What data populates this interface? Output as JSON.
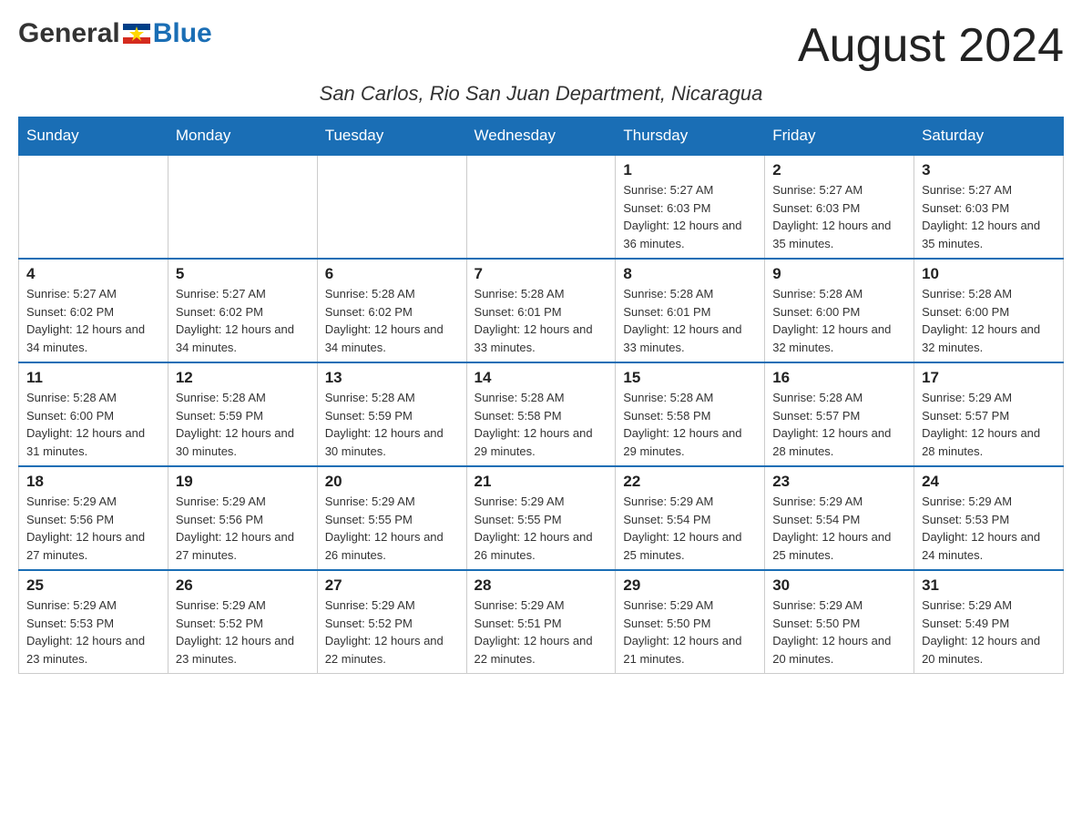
{
  "header": {
    "logo": {
      "general": "General",
      "blue": "Blue"
    },
    "month_title": "August 2024",
    "location": "San Carlos, Rio San Juan Department, Nicaragua"
  },
  "weekdays": [
    "Sunday",
    "Monday",
    "Tuesday",
    "Wednesday",
    "Thursday",
    "Friday",
    "Saturday"
  ],
  "weeks": [
    [
      {
        "day": "",
        "info": ""
      },
      {
        "day": "",
        "info": ""
      },
      {
        "day": "",
        "info": ""
      },
      {
        "day": "",
        "info": ""
      },
      {
        "day": "1",
        "info": "Sunrise: 5:27 AM\nSunset: 6:03 PM\nDaylight: 12 hours and 36 minutes."
      },
      {
        "day": "2",
        "info": "Sunrise: 5:27 AM\nSunset: 6:03 PM\nDaylight: 12 hours and 35 minutes."
      },
      {
        "day": "3",
        "info": "Sunrise: 5:27 AM\nSunset: 6:03 PM\nDaylight: 12 hours and 35 minutes."
      }
    ],
    [
      {
        "day": "4",
        "info": "Sunrise: 5:27 AM\nSunset: 6:02 PM\nDaylight: 12 hours and 34 minutes."
      },
      {
        "day": "5",
        "info": "Sunrise: 5:27 AM\nSunset: 6:02 PM\nDaylight: 12 hours and 34 minutes."
      },
      {
        "day": "6",
        "info": "Sunrise: 5:28 AM\nSunset: 6:02 PM\nDaylight: 12 hours and 34 minutes."
      },
      {
        "day": "7",
        "info": "Sunrise: 5:28 AM\nSunset: 6:01 PM\nDaylight: 12 hours and 33 minutes."
      },
      {
        "day": "8",
        "info": "Sunrise: 5:28 AM\nSunset: 6:01 PM\nDaylight: 12 hours and 33 minutes."
      },
      {
        "day": "9",
        "info": "Sunrise: 5:28 AM\nSunset: 6:00 PM\nDaylight: 12 hours and 32 minutes."
      },
      {
        "day": "10",
        "info": "Sunrise: 5:28 AM\nSunset: 6:00 PM\nDaylight: 12 hours and 32 minutes."
      }
    ],
    [
      {
        "day": "11",
        "info": "Sunrise: 5:28 AM\nSunset: 6:00 PM\nDaylight: 12 hours and 31 minutes."
      },
      {
        "day": "12",
        "info": "Sunrise: 5:28 AM\nSunset: 5:59 PM\nDaylight: 12 hours and 30 minutes."
      },
      {
        "day": "13",
        "info": "Sunrise: 5:28 AM\nSunset: 5:59 PM\nDaylight: 12 hours and 30 minutes."
      },
      {
        "day": "14",
        "info": "Sunrise: 5:28 AM\nSunset: 5:58 PM\nDaylight: 12 hours and 29 minutes."
      },
      {
        "day": "15",
        "info": "Sunrise: 5:28 AM\nSunset: 5:58 PM\nDaylight: 12 hours and 29 minutes."
      },
      {
        "day": "16",
        "info": "Sunrise: 5:28 AM\nSunset: 5:57 PM\nDaylight: 12 hours and 28 minutes."
      },
      {
        "day": "17",
        "info": "Sunrise: 5:29 AM\nSunset: 5:57 PM\nDaylight: 12 hours and 28 minutes."
      }
    ],
    [
      {
        "day": "18",
        "info": "Sunrise: 5:29 AM\nSunset: 5:56 PM\nDaylight: 12 hours and 27 minutes."
      },
      {
        "day": "19",
        "info": "Sunrise: 5:29 AM\nSunset: 5:56 PM\nDaylight: 12 hours and 27 minutes."
      },
      {
        "day": "20",
        "info": "Sunrise: 5:29 AM\nSunset: 5:55 PM\nDaylight: 12 hours and 26 minutes."
      },
      {
        "day": "21",
        "info": "Sunrise: 5:29 AM\nSunset: 5:55 PM\nDaylight: 12 hours and 26 minutes."
      },
      {
        "day": "22",
        "info": "Sunrise: 5:29 AM\nSunset: 5:54 PM\nDaylight: 12 hours and 25 minutes."
      },
      {
        "day": "23",
        "info": "Sunrise: 5:29 AM\nSunset: 5:54 PM\nDaylight: 12 hours and 25 minutes."
      },
      {
        "day": "24",
        "info": "Sunrise: 5:29 AM\nSunset: 5:53 PM\nDaylight: 12 hours and 24 minutes."
      }
    ],
    [
      {
        "day": "25",
        "info": "Sunrise: 5:29 AM\nSunset: 5:53 PM\nDaylight: 12 hours and 23 minutes."
      },
      {
        "day": "26",
        "info": "Sunrise: 5:29 AM\nSunset: 5:52 PM\nDaylight: 12 hours and 23 minutes."
      },
      {
        "day": "27",
        "info": "Sunrise: 5:29 AM\nSunset: 5:52 PM\nDaylight: 12 hours and 22 minutes."
      },
      {
        "day": "28",
        "info": "Sunrise: 5:29 AM\nSunset: 5:51 PM\nDaylight: 12 hours and 22 minutes."
      },
      {
        "day": "29",
        "info": "Sunrise: 5:29 AM\nSunset: 5:50 PM\nDaylight: 12 hours and 21 minutes."
      },
      {
        "day": "30",
        "info": "Sunrise: 5:29 AM\nSunset: 5:50 PM\nDaylight: 12 hours and 20 minutes."
      },
      {
        "day": "31",
        "info": "Sunrise: 5:29 AM\nSunset: 5:49 PM\nDaylight: 12 hours and 20 minutes."
      }
    ]
  ]
}
